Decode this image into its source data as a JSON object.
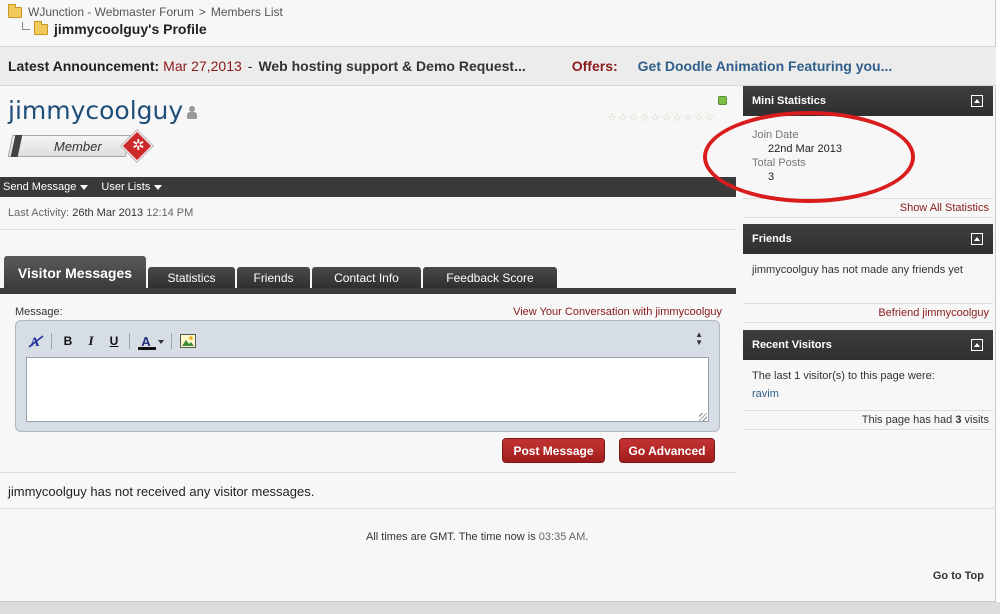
{
  "breadcrumb": {
    "forum": "WJunction - Webmaster Forum",
    "separator": ">",
    "section": "Members List",
    "page": "jimmycoolguy's Profile"
  },
  "announcement": {
    "label": "Latest Announcement:",
    "date": "Mar 27,2013",
    "dash": "-",
    "title": "Web hosting support & Demo Request...",
    "offers_label": "Offers:",
    "offers_link": "Get Doodle Animation Featuring you..."
  },
  "profile": {
    "username": "jimmycoolguy",
    "rank": "Member",
    "rank_mark": "✲",
    "status_color": "#7bc044",
    "reputation_stars": 10,
    "actions": [
      "Send Message",
      "User Lists"
    ],
    "last_activity_label": "Last Activity:",
    "last_activity_date": "26th Mar 2013",
    "last_activity_time": "12:14 PM"
  },
  "tabs": [
    {
      "label": "Visitor Messages",
      "active": true
    },
    {
      "label": "Statistics"
    },
    {
      "label": "Friends"
    },
    {
      "label": "Contact Info"
    },
    {
      "label": "Feedback Score"
    }
  ],
  "message_form": {
    "label": "Message:",
    "conversation_link": "View Your Conversation with jimmycoolguy",
    "textarea_value": "",
    "toolbar": [
      "remove-format-icon",
      "bold",
      "italic",
      "underline",
      "font-color",
      "insert-image-icon"
    ],
    "bold_label": "B",
    "italic_label": "I",
    "underline_label": "U",
    "color_label": "A",
    "post_button": "Post Message",
    "advanced_button": "Go Advanced"
  },
  "visitor_messages_empty": "jimmycoolguy has not received any visitor messages.",
  "footer": {
    "times_prefix": "All times are GMT. The time now is",
    "time_now": "03:35 AM",
    "times_suffix": ".",
    "go_to_top": "Go to Top"
  },
  "sidebar": {
    "mini_statistics": {
      "title": "Mini Statistics",
      "join_date_label": "Join Date",
      "join_date": "22nd Mar 2013",
      "total_posts_label": "Total Posts",
      "total_posts": "3",
      "footer_link": "Show All Statistics"
    },
    "friends": {
      "title": "Friends",
      "body": "jimmycoolguy has not made any friends yet",
      "footer_link": "Befriend jimmycoolguy"
    },
    "recent_visitors": {
      "title": "Recent Visitors",
      "intro": "The last 1 visitor(s) to this page were:",
      "visitors": [
        "ravim"
      ],
      "visits_prefix": "This page has had",
      "visits_count": "3",
      "visits_suffix": "visits"
    }
  },
  "colors": {
    "accent_red": "#8b1a1a",
    "link_blue": "#2f5f8a",
    "username_blue": "#1f4e79",
    "bar_dark": "#3a3a3a",
    "button_red": "#b22525",
    "highlight_ellipse": "#d91d1d"
  }
}
